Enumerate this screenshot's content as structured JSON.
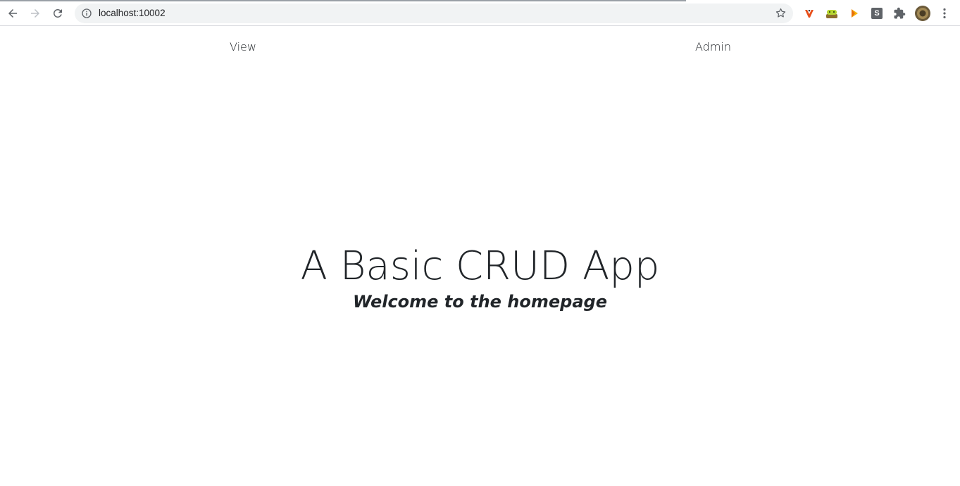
{
  "browser": {
    "url": "localhost:10002"
  },
  "nav": {
    "view_label": "View",
    "admin_label": "Admin"
  },
  "hero": {
    "title": "A Basic CRUD App",
    "subtitle": "Welcome to the homepage"
  },
  "icons": {
    "back": "back-arrow-icon",
    "forward": "forward-arrow-icon",
    "reload": "reload-icon",
    "site_info": "info-icon",
    "bookmark": "star-icon",
    "extensions": "puzzle-icon",
    "menu": "kebab-menu-icon"
  },
  "extension_badge_letter": "S",
  "colors": {
    "text": "#212529",
    "omnibox": "#f1f3f4"
  }
}
